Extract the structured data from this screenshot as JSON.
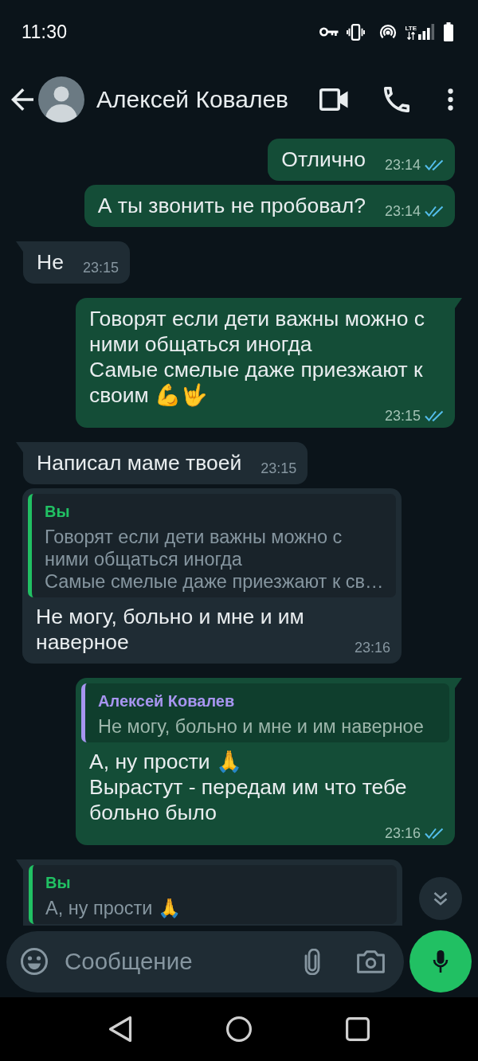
{
  "status_bar": {
    "time": "11:30",
    "network": "LTE"
  },
  "header": {
    "contact_name": "Алексей Ковалев"
  },
  "messages": [
    {
      "kind": "outgoing",
      "tail": false,
      "text": "Отлично",
      "time": "23:14",
      "read": true
    },
    {
      "kind": "outgoing",
      "tail": false,
      "text": "А ты звонить не пробовал?",
      "time": "23:14",
      "read": true
    },
    {
      "kind": "incoming",
      "tail": true,
      "text": "Не",
      "time": "23:15"
    },
    {
      "kind": "outgoing",
      "tail": true,
      "text": "Говорят если дети важны можно с ними общаться иногда\nСамые смелые даже приезжают к своим 💪🤟",
      "time": "23:15",
      "read": true
    },
    {
      "kind": "incoming",
      "tail": true,
      "text": "Написал маме твоей",
      "time": "23:15"
    },
    {
      "kind": "incoming",
      "tail": false,
      "reply": {
        "author": "Вы",
        "color": "#21c063",
        "text": "Говорят если дети важны можно с ними общаться иногда\nСамые смелые даже приезжают к св…"
      },
      "text": "Не могу, больно и мне и им наверное",
      "time": "23:16"
    },
    {
      "kind": "outgoing",
      "tail": true,
      "reply": {
        "author": "Алексей Ковалев",
        "color": "#a795f0",
        "text": "Не могу, больно и мне и им наверное"
      },
      "text": "А, ну прости 🙏\nВырастут - передам им что тебе больно было",
      "time": "23:16",
      "read": true
    },
    {
      "kind": "incoming",
      "tail": true,
      "reply": {
        "author": "Вы",
        "color": "#21c063",
        "text": "А, ну прости 🙏"
      }
    }
  ],
  "composer": {
    "placeholder": "Сообщение"
  }
}
